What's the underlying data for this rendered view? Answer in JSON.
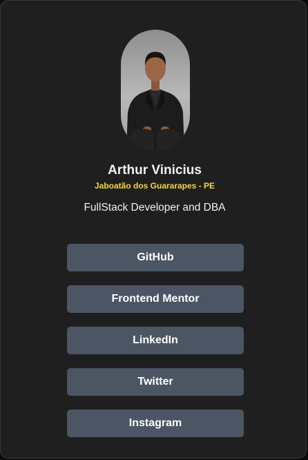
{
  "profile": {
    "name": "Arthur Vinicius",
    "location": "Jaboatão dos Guararapes - PE",
    "bio": "FullStack Developer and DBA",
    "accent_color": "#f4d447",
    "avatar_icon": "profile-photo"
  },
  "links": [
    {
      "label": "GitHub"
    },
    {
      "label": "Frontend Mentor"
    },
    {
      "label": "LinkedIn"
    },
    {
      "label": "Twitter"
    },
    {
      "label": "Instagram"
    }
  ],
  "colors": {
    "background": "#1f1f1f",
    "button": "#4b5563",
    "text": "#ffffff"
  }
}
